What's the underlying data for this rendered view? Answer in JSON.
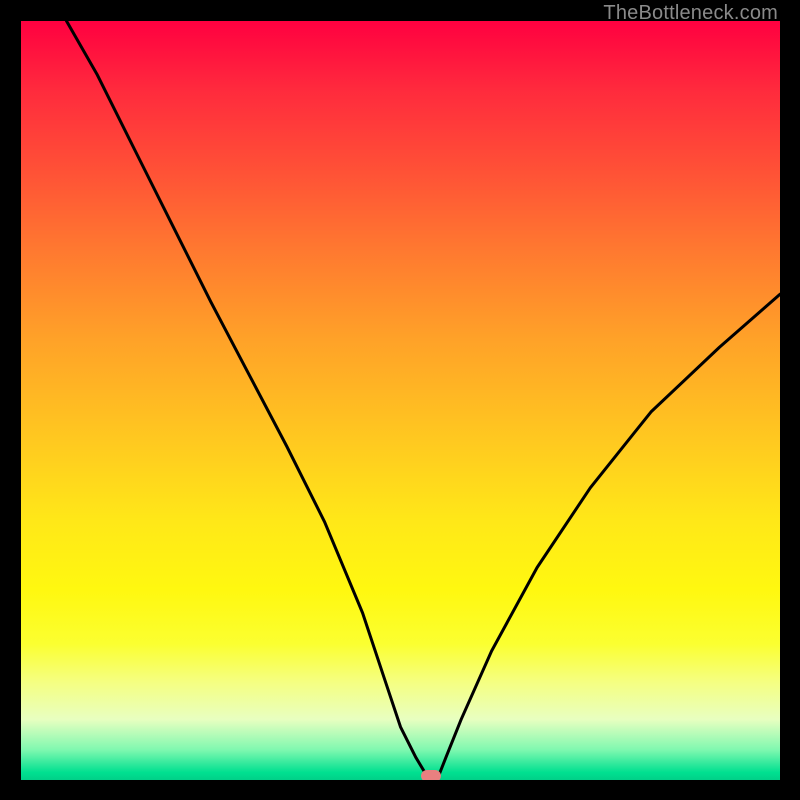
{
  "watermark": "TheBottleneck.com",
  "chart_data": {
    "type": "line",
    "title": "",
    "xlabel": "",
    "ylabel": "",
    "x_range": [
      0,
      100
    ],
    "y_range": [
      0,
      100
    ],
    "series": [
      {
        "name": "bottleneck-curve",
        "x": [
          6,
          10,
          15,
          20,
          25,
          30,
          35,
          40,
          45,
          48,
          50,
          52,
          53.5,
          55,
          56,
          58,
          62,
          68,
          75,
          83,
          92,
          100
        ],
        "y": [
          100,
          93,
          83,
          73,
          63,
          53.5,
          44,
          34,
          22,
          13,
          7,
          3,
          0.5,
          0.5,
          3,
          8,
          17,
          28,
          38.5,
          48.5,
          57,
          64
        ]
      }
    ],
    "minimum_point": {
      "x": 54,
      "y": 0.5
    },
    "gradient_scale": {
      "top_color": "#ff0040",
      "bottom_color": "#00d088",
      "meaning": "red = high bottleneck, green = no bottleneck"
    }
  }
}
